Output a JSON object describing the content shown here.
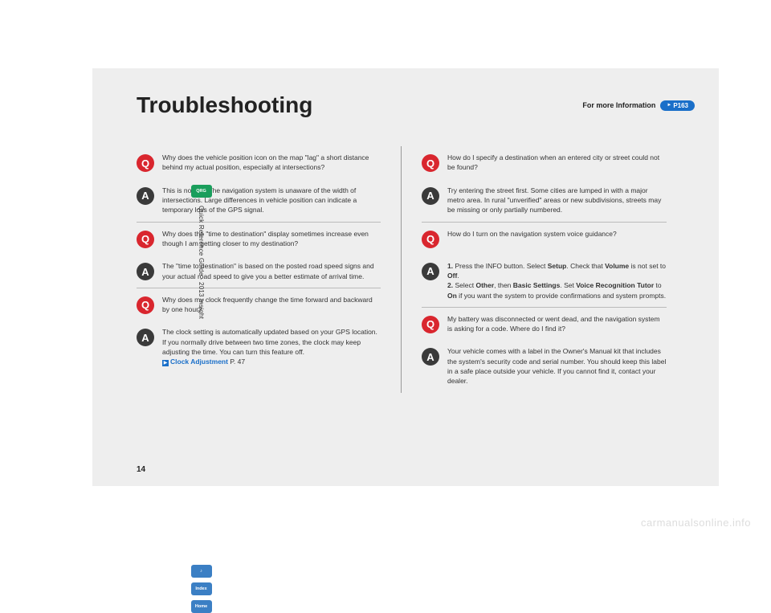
{
  "header": {
    "title": "Troubleshooting",
    "more_label": "For more Information",
    "more_ref": "P163"
  },
  "sidebar": {
    "qrg": "QRG",
    "guide": "Quick Reference Guide - 2013 Insight",
    "voice": "♪",
    "index": "Index",
    "home": "Home"
  },
  "left": [
    {
      "type": "q",
      "text": "Why does the vehicle position icon on the map \"lag\" a short distance behind my actual position, especially at intersections?"
    },
    {
      "type": "a",
      "text": "This is normal. The navigation system is unaware of the width of intersections. Large differences in vehicle position can indicate a temporary loss of the GPS signal."
    },
    {
      "type": "q",
      "text": "Why does the \"time to destination\" display sometimes increase even though I am getting closer to my destination?"
    },
    {
      "type": "a",
      "text": "The \"time to destination\" is based on the posted road speed signs and your actual road speed to give you a better estimate of arrival time."
    },
    {
      "type": "q",
      "text": "Why does my clock frequently change the time forward and backward by one hour?"
    },
    {
      "type": "a",
      "text": "The clock setting is automatically updated based on your GPS location. If you normally drive between two time zones, the clock may keep adjusting the time. You can turn this feature off.",
      "link_label": "Clock Adjustment",
      "link_page": "P. 47"
    }
  ],
  "right": [
    {
      "type": "q",
      "text": "How do I specify a destination when an entered city or street could not be found?"
    },
    {
      "type": "a",
      "text": "Try entering the street first. Some cities are lumped in with a major metro area. In rural \"unverified\" areas or new subdivisions, streets may be missing or only partially numbered."
    },
    {
      "type": "q",
      "text": "How do I turn on the navigation system voice guidance?"
    },
    {
      "type": "a",
      "steps": {
        "s1a": "Press the INFO button. Select ",
        "s1b": "Setup",
        "s1c": ". Check that ",
        "s1d": "Volume",
        "s1e": " is not set to ",
        "s1f": "Off",
        "s1g": ".",
        "s2a": "Select ",
        "s2b": "Other",
        "s2c": ", then ",
        "s2d": "Basic Settings",
        "s2e": ". Set ",
        "s2f": "Voice Recognition Tutor",
        "s2g": " to ",
        "s2h": "On",
        "s2i": " if you want the system to provide confirmations and system prompts."
      }
    },
    {
      "type": "q",
      "text": "My battery was disconnected or went dead, and the navigation system is asking for a code. Where do I find it?"
    },
    {
      "type": "a",
      "text": "Your vehicle comes with a label in the Owner's Manual kit that includes the system's security code and serial number. You should keep this label in a safe place outside your vehicle. If you cannot find it, contact your dealer."
    }
  ],
  "pagenum": "14",
  "watermark": "carmanualsonline.info"
}
